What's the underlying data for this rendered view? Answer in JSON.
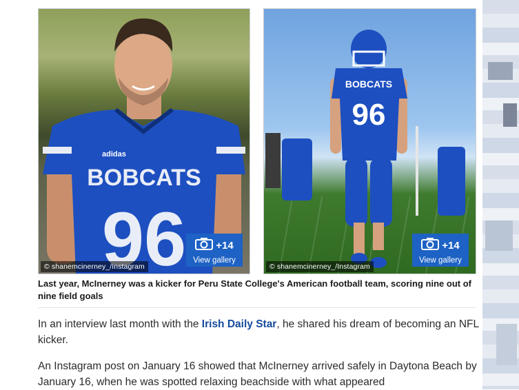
{
  "images": [
    {
      "credit": "© shanemcinerney_/Instagram",
      "jersey_team": "BOBCATS",
      "jersey_number": "96",
      "gallery": {
        "count": "+14",
        "label": "View gallery",
        "icon": "camera-icon"
      }
    },
    {
      "credit": "© shanemcinerney_/Instagram",
      "jersey_team": "BOBCATS",
      "jersey_number": "96",
      "gallery": {
        "count": "+14",
        "label": "View gallery",
        "icon": "camera-icon"
      }
    }
  ],
  "caption": "Last year, McInerney was a kicker for Peru State College's American football team, scoring nine out of nine field goals",
  "article": {
    "p1_before": "In an interview last month with the ",
    "p1_link": "Irish Daily Star",
    "p1_after": ", he shared his dream of becoming an NFL kicker.",
    "p2": "An Instagram post on January 16 showed that McInerney arrived safely in Daytona Beach by January 16, when he was spotted relaxing beachside with what appeared"
  },
  "colors": {
    "gallery_button": "#1d62c4",
    "link": "#154a9c",
    "jersey_blue": "#1d4fc0"
  }
}
